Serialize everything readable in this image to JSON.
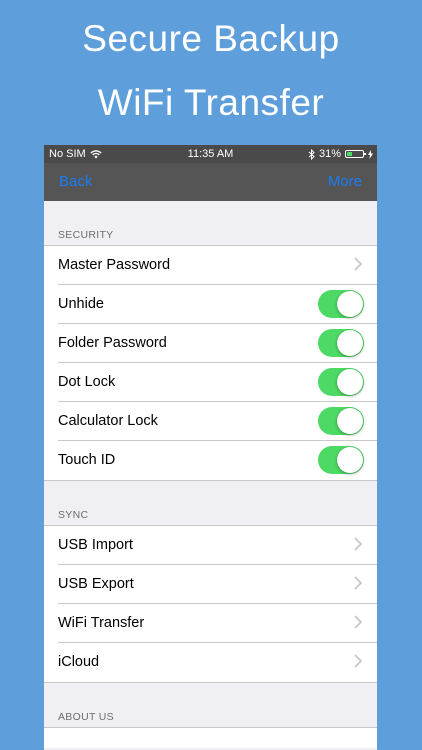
{
  "promo": {
    "line1": "Secure Backup",
    "line2": "WiFi Transfer"
  },
  "status_bar": {
    "carrier": "No SIM",
    "time": "11:35 AM",
    "battery_percent": "31%",
    "battery_level": 0.31
  },
  "nav": {
    "back_label": "Back",
    "more_label": "More"
  },
  "sections": [
    {
      "header": "SECURITY",
      "rows": [
        {
          "label": "Master Password",
          "accessory": "chevron"
        },
        {
          "label": "Unhide",
          "accessory": "toggle",
          "on": true
        },
        {
          "label": "Folder Password",
          "accessory": "toggle",
          "on": true
        },
        {
          "label": "Dot Lock",
          "accessory": "toggle",
          "on": true
        },
        {
          "label": "Calculator Lock",
          "accessory": "toggle",
          "on": true
        },
        {
          "label": "Touch ID",
          "accessory": "toggle",
          "on": true
        }
      ]
    },
    {
      "header": "SYNC",
      "rows": [
        {
          "label": "USB Import",
          "accessory": "chevron"
        },
        {
          "label": "USB Export",
          "accessory": "chevron"
        },
        {
          "label": "WiFi Transfer",
          "accessory": "chevron"
        },
        {
          "label": "iCloud",
          "accessory": "chevron"
        }
      ]
    },
    {
      "header": "ABOUT US",
      "rows": []
    }
  ],
  "colors": {
    "background": "#5e9fdb",
    "toggle_on": "#4cd964",
    "nav_tint": "#1a7cf4"
  }
}
